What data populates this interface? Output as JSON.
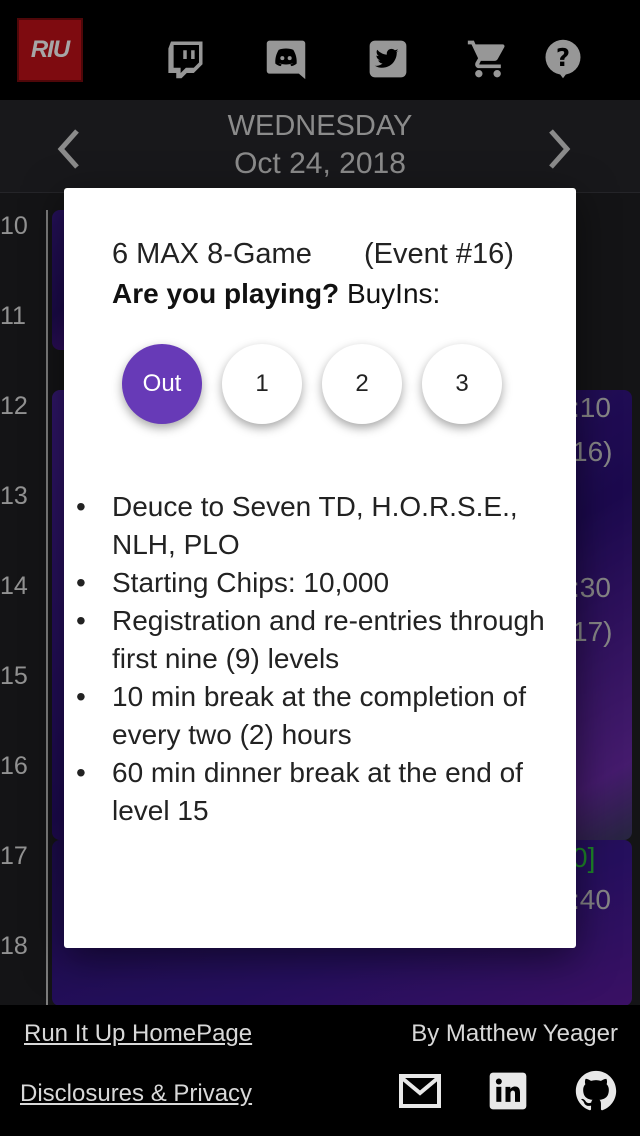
{
  "header": {
    "logo_text": "RIU",
    "icons": [
      "twitch-icon",
      "discord-icon",
      "twitter-icon",
      "cart-icon",
      "help-icon"
    ]
  },
  "date_nav": {
    "weekday": "WEDNESDAY",
    "date": "Oct 24, 2018"
  },
  "timeline": {
    "hours": [
      "10",
      "11",
      "12",
      "13",
      "14",
      "15",
      "16",
      "17",
      "18"
    ],
    "background_fragments": [
      ":10",
      "16)",
      ":30",
      "17)",
      "0]",
      ":40"
    ]
  },
  "modal": {
    "event_name": "6 MAX 8-Game",
    "event_number": "(Event #16)",
    "question": "Are you playing?",
    "buyins_label": "BuyIns:",
    "buyin_options": [
      "Out",
      "1",
      "2",
      "3"
    ],
    "selected_option": "Out",
    "rules": [
      "Deuce to Seven TD, H.O.R.S.E., NLH, PLO",
      "Starting Chips: 10,000",
      "Registration and re-entries through first nine (9) levels",
      "10 min break at the completion of every two (2) hours",
      "60 min dinner break at the end of level 15"
    ]
  },
  "footer": {
    "homepage_link": "Run It Up HomePage",
    "disclosures_link": "Disclosures & Privacy",
    "author": "By Matthew Yeager",
    "icons": [
      "mail-icon",
      "linkedin-icon",
      "github-icon"
    ]
  },
  "colors": {
    "accent": "#673ab7",
    "logo_red": "#c2121a",
    "background": "#1f1f22"
  }
}
